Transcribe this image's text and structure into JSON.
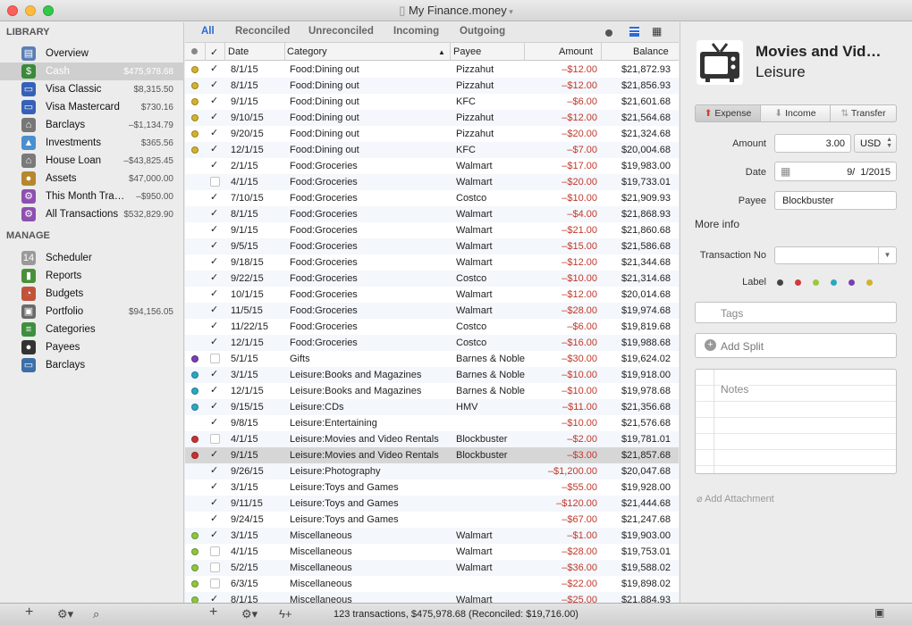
{
  "window": {
    "title": "My Finance.money"
  },
  "sidebar": {
    "library_title": "LIBRARY",
    "manage_title": "MANAGE",
    "library": [
      {
        "label": "Overview",
        "value": "",
        "icon": "overview-icon",
        "color": "#5b7fb5",
        "glyph": "▤"
      },
      {
        "label": "Cash",
        "value": "$475,978.68",
        "icon": "cash-icon",
        "color": "#3a8a3a",
        "glyph": "$"
      },
      {
        "label": "Visa Classic",
        "value": "$8,315.50",
        "icon": "credit-card-icon",
        "color": "#3561b8",
        "glyph": "▭"
      },
      {
        "label": "Visa Mastercard",
        "value": "$730.16",
        "icon": "credit-card-icon",
        "color": "#3561b8",
        "glyph": "▭"
      },
      {
        "label": "Barclays",
        "value": "–$1,134.79",
        "icon": "bank-icon",
        "color": "#777777",
        "glyph": "⌂"
      },
      {
        "label": "Investments",
        "value": "$365.56",
        "icon": "chart-icon",
        "color": "#4a8fd0",
        "glyph": "▲"
      },
      {
        "label": "House Loan",
        "value": "–$43,825.45",
        "icon": "house-icon",
        "color": "#7a7a7a",
        "glyph": "⌂"
      },
      {
        "label": "Assets",
        "value": "$47,000.00",
        "icon": "money-bag-icon",
        "color": "#b7862e",
        "glyph": "●"
      },
      {
        "label": "This Month Tra…",
        "value": "–$950.00",
        "icon": "smart-folder-icon",
        "color": "#8e4fb0",
        "glyph": "⚙"
      },
      {
        "label": "All Transactions",
        "value": "$532,829.90",
        "icon": "smart-folder-icon",
        "color": "#8e4fb0",
        "glyph": "⚙"
      }
    ],
    "manage": [
      {
        "label": "Scheduler",
        "value": "",
        "icon": "calendar-icon",
        "color": "#9a9a9a",
        "glyph": "14"
      },
      {
        "label": "Reports",
        "value": "",
        "icon": "bar-chart-icon",
        "color": "#4a8f3a",
        "glyph": "▮"
      },
      {
        "label": "Budgets",
        "value": "",
        "icon": "gauge-icon",
        "color": "#c0533a",
        "glyph": "◔"
      },
      {
        "label": "Portfolio",
        "value": "$94,156.05",
        "icon": "briefcase-icon",
        "color": "#6a6a6a",
        "glyph": "▣"
      },
      {
        "label": "Categories",
        "value": "",
        "icon": "categories-icon",
        "color": "#3f8f3f",
        "glyph": "≡"
      },
      {
        "label": "Payees",
        "value": "",
        "icon": "person-icon",
        "color": "#333333",
        "glyph": "●"
      },
      {
        "label": "Barclays",
        "value": "",
        "icon": "monitor-icon",
        "color": "#3c6fa8",
        "glyph": "▭"
      }
    ]
  },
  "filters": [
    "All",
    "Reconciled",
    "Unreconciled",
    "Incoming",
    "Outgoing"
  ],
  "columns": {
    "date": "Date",
    "category": "Category",
    "payee": "Payee",
    "amount": "Amount",
    "balance": "Balance"
  },
  "transactions": [
    {
      "dot": "#d4b22b",
      "checked": true,
      "date": "8/1/15",
      "category": "Food:Dining out",
      "payee": "Pizzahut",
      "amount": "–$12.00",
      "balance": "$21,872.93"
    },
    {
      "dot": "#d4b22b",
      "checked": true,
      "date": "8/1/15",
      "category": "Food:Dining out",
      "payee": "Pizzahut",
      "amount": "–$12.00",
      "balance": "$21,856.93"
    },
    {
      "dot": "#d4b22b",
      "checked": true,
      "date": "9/1/15",
      "category": "Food:Dining out",
      "payee": "KFC",
      "amount": "–$6.00",
      "balance": "$21,601.68"
    },
    {
      "dot": "#d4b22b",
      "checked": true,
      "date": "9/10/15",
      "category": "Food:Dining out",
      "payee": "Pizzahut",
      "amount": "–$12.00",
      "balance": "$21,564.68"
    },
    {
      "dot": "#d4b22b",
      "checked": true,
      "date": "9/20/15",
      "category": "Food:Dining out",
      "payee": "Pizzahut",
      "amount": "–$20.00",
      "balance": "$21,324.68"
    },
    {
      "dot": "#d4b22b",
      "checked": true,
      "date": "12/1/15",
      "category": "Food:Dining out",
      "payee": "KFC",
      "amount": "–$7.00",
      "balance": "$20,004.68"
    },
    {
      "dot": "",
      "checked": true,
      "date": "2/1/15",
      "category": "Food:Groceries",
      "payee": "Walmart",
      "amount": "–$17.00",
      "balance": "$19,983.00"
    },
    {
      "dot": "",
      "checked": false,
      "date": "4/1/15",
      "category": "Food:Groceries",
      "payee": "Walmart",
      "amount": "–$20.00",
      "balance": "$19,733.01"
    },
    {
      "dot": "",
      "checked": true,
      "date": "7/10/15",
      "category": "Food:Groceries",
      "payee": "Costco",
      "amount": "–$10.00",
      "balance": "$21,909.93"
    },
    {
      "dot": "",
      "checked": true,
      "date": "8/1/15",
      "category": "Food:Groceries",
      "payee": "Walmart",
      "amount": "–$4.00",
      "balance": "$21,868.93"
    },
    {
      "dot": "",
      "checked": true,
      "date": "9/1/15",
      "category": "Food:Groceries",
      "payee": "Walmart",
      "amount": "–$21.00",
      "balance": "$21,860.68"
    },
    {
      "dot": "",
      "checked": true,
      "date": "9/5/15",
      "category": "Food:Groceries",
      "payee": "Walmart",
      "amount": "–$15.00",
      "balance": "$21,586.68"
    },
    {
      "dot": "",
      "checked": true,
      "date": "9/18/15",
      "category": "Food:Groceries",
      "payee": "Walmart",
      "amount": "–$12.00",
      "balance": "$21,344.68"
    },
    {
      "dot": "",
      "checked": true,
      "date": "9/22/15",
      "category": "Food:Groceries",
      "payee": "Costco",
      "amount": "–$10.00",
      "balance": "$21,314.68"
    },
    {
      "dot": "",
      "checked": true,
      "date": "10/1/15",
      "category": "Food:Groceries",
      "payee": "Walmart",
      "amount": "–$12.00",
      "balance": "$20,014.68"
    },
    {
      "dot": "",
      "checked": true,
      "date": "11/5/15",
      "category": "Food:Groceries",
      "payee": "Walmart",
      "amount": "–$28.00",
      "balance": "$19,974.68"
    },
    {
      "dot": "",
      "checked": true,
      "date": "11/22/15",
      "category": "Food:Groceries",
      "payee": "Costco",
      "amount": "–$6.00",
      "balance": "$19,819.68"
    },
    {
      "dot": "",
      "checked": true,
      "date": "12/1/15",
      "category": "Food:Groceries",
      "payee": "Costco",
      "amount": "–$16.00",
      "balance": "$19,988.68"
    },
    {
      "dot": "#7a3fb0",
      "checked": false,
      "date": "5/1/15",
      "category": "Gifts",
      "payee": "Barnes & Noble",
      "amount": "–$30.00",
      "balance": "$19,624.02"
    },
    {
      "dot": "#2aa8c2",
      "checked": true,
      "date": "3/1/15",
      "category": "Leisure:Books and Magazines",
      "payee": "Barnes & Noble",
      "amount": "–$10.00",
      "balance": "$19,918.00"
    },
    {
      "dot": "#2aa8c2",
      "checked": true,
      "date": "12/1/15",
      "category": "Leisure:Books and Magazines",
      "payee": "Barnes & Noble",
      "amount": "–$10.00",
      "balance": "$19,978.68"
    },
    {
      "dot": "#2aa8c2",
      "checked": true,
      "date": "9/15/15",
      "category": "Leisure:CDs",
      "payee": "HMV",
      "amount": "–$11.00",
      "balance": "$21,356.68"
    },
    {
      "dot": "",
      "checked": true,
      "date": "9/8/15",
      "category": "Leisure:Entertaining",
      "payee": "",
      "amount": "–$10.00",
      "balance": "$21,576.68"
    },
    {
      "dot": "#c83232",
      "checked": false,
      "date": "4/1/15",
      "category": "Leisure:Movies and Video Rentals",
      "payee": "Blockbuster",
      "amount": "–$2.00",
      "balance": "$19,781.01"
    },
    {
      "dot": "#c83232",
      "checked": true,
      "date": "9/1/15",
      "category": "Leisure:Movies and Video Rentals",
      "payee": "Blockbuster",
      "amount": "–$3.00",
      "balance": "$21,857.68"
    },
    {
      "dot": "",
      "checked": true,
      "date": "9/26/15",
      "category": "Leisure:Photography",
      "payee": "",
      "amount": "–$1,200.00",
      "balance": "$20,047.68"
    },
    {
      "dot": "",
      "checked": true,
      "date": "3/1/15",
      "category": "Leisure:Toys and Games",
      "payee": "",
      "amount": "–$55.00",
      "balance": "$19,928.00"
    },
    {
      "dot": "",
      "checked": true,
      "date": "9/11/15",
      "category": "Leisure:Toys and Games",
      "payee": "",
      "amount": "–$120.00",
      "balance": "$21,444.68"
    },
    {
      "dot": "",
      "checked": true,
      "date": "9/24/15",
      "category": "Leisure:Toys and Games",
      "payee": "",
      "amount": "–$67.00",
      "balance": "$21,247.68"
    },
    {
      "dot": "#8dc63f",
      "checked": true,
      "date": "3/1/15",
      "category": "Miscellaneous",
      "payee": "Walmart",
      "amount": "–$1.00",
      "balance": "$19,903.00"
    },
    {
      "dot": "#8dc63f",
      "checked": false,
      "date": "4/1/15",
      "category": "Miscellaneous",
      "payee": "Walmart",
      "amount": "–$28.00",
      "balance": "$19,753.01"
    },
    {
      "dot": "#8dc63f",
      "checked": false,
      "date": "5/2/15",
      "category": "Miscellaneous",
      "payee": "Walmart",
      "amount": "–$36.00",
      "balance": "$19,588.02"
    },
    {
      "dot": "#8dc63f",
      "checked": false,
      "date": "6/3/15",
      "category": "Miscellaneous",
      "payee": "",
      "amount": "–$22.00",
      "balance": "$19,898.02"
    },
    {
      "dot": "#8dc63f",
      "checked": true,
      "date": "8/1/15",
      "category": "Miscellaneous",
      "payee": "Walmart",
      "amount": "–$25.00",
      "balance": "$21,884.93"
    }
  ],
  "detail": {
    "title": "Movies and Vid…",
    "subtitle": "Leisure",
    "type_buttons": [
      "Expense",
      "Income",
      "Transfer"
    ],
    "amount_label": "Amount",
    "amount_value": "3.00",
    "currency": "USD",
    "date_label": "Date",
    "date_value": "9/  1/2015",
    "payee_label": "Payee",
    "payee_value": "Blockbuster",
    "more_info": "More info",
    "txn_no_label": "Transaction No",
    "label_label": "Label",
    "label_colors": [
      "#444444",
      "#d03a3a",
      "#9cc93a",
      "#2aa8c2",
      "#7a3fb0",
      "#d4b22b"
    ],
    "tags_placeholder": "Tags",
    "add_split": "Add Split",
    "notes_placeholder": "Notes",
    "add_attachment": "Add Attachment"
  },
  "status": "123 transactions, $475,978.68 (Reconciled: $19,716.00)",
  "accent": "#2a6ad8"
}
